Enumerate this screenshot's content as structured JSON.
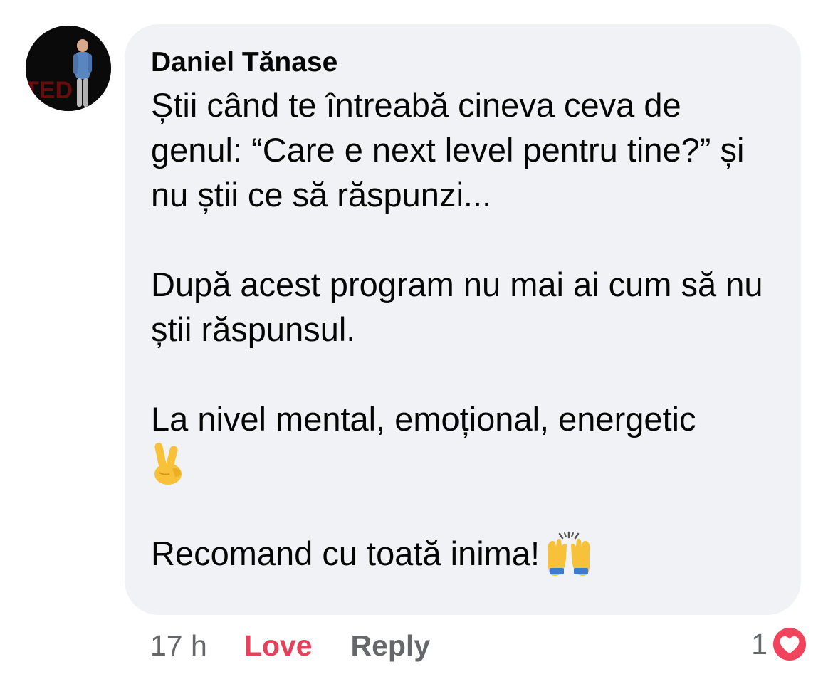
{
  "comment": {
    "author": "Daniel Tănase",
    "avatar_icon": "profile-photo",
    "paragraphs": [
      "Știi când te întreabă cineva ceva de genul: “Care e next level pentru tine?” și nu știi ce să răspunzi...",
      "După acest program nu mai ai cum să nu știi răspunsul.",
      "La nivel mental, emoțional, energetic",
      "Recomand cu toată inima!"
    ],
    "emojis": [
      "victory-hand-emoji",
      "raising-hands-emoji"
    ],
    "bubble_color": "#f0f2f5"
  },
  "actions": {
    "timestamp": "17 h",
    "love_label": "Love",
    "reply_label": "Reply",
    "love_color": "#e4415b"
  },
  "reactions": {
    "count": "1",
    "icon": "love-reaction-icon"
  }
}
